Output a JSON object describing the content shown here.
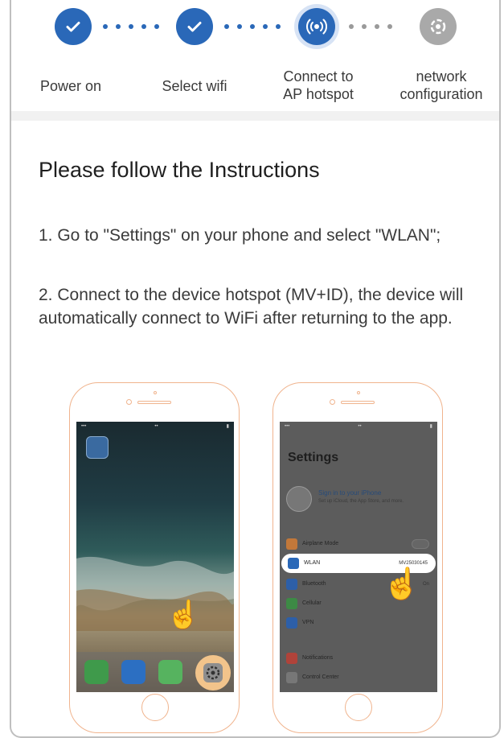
{
  "stepper": {
    "steps": [
      {
        "label": "Power on",
        "state": "done",
        "icon": "check-icon"
      },
      {
        "label": "Select wifi",
        "state": "done",
        "icon": "check-icon"
      },
      {
        "label": "Connect to\nAP hotspot",
        "state": "active",
        "icon": "hotspot-icon"
      },
      {
        "label": "network\nconfiguration",
        "state": "todo",
        "icon": "gear-icon"
      }
    ]
  },
  "instructions": {
    "title": "Please follow the Instructions",
    "step1": "1. Go to \"Settings\" on your phone and select \"WLAN\";",
    "step2": "2. Connect to the device hotspot (MV+ID), the device will automatically connect to WiFi after returning to the app."
  },
  "phone_settings": {
    "title": "Settings",
    "profile_line1": "Sign in to your iPhone",
    "profile_line2": "Set up iCloud, the App Store, and more.",
    "rows": [
      {
        "label": "Airplane Mode",
        "value": ""
      },
      {
        "label": "WLAN",
        "value": "MV25030145"
      },
      {
        "label": "Bluetooth",
        "value": "On"
      },
      {
        "label": "Cellular",
        "value": ""
      },
      {
        "label": "VPN",
        "value": ""
      },
      {
        "label": "Notifications",
        "value": ""
      },
      {
        "label": "Control Center",
        "value": ""
      }
    ]
  },
  "colors": {
    "accent": "#2a68b8",
    "inactive": "#a9a9a9",
    "phone_outline": "#f0b48e"
  }
}
